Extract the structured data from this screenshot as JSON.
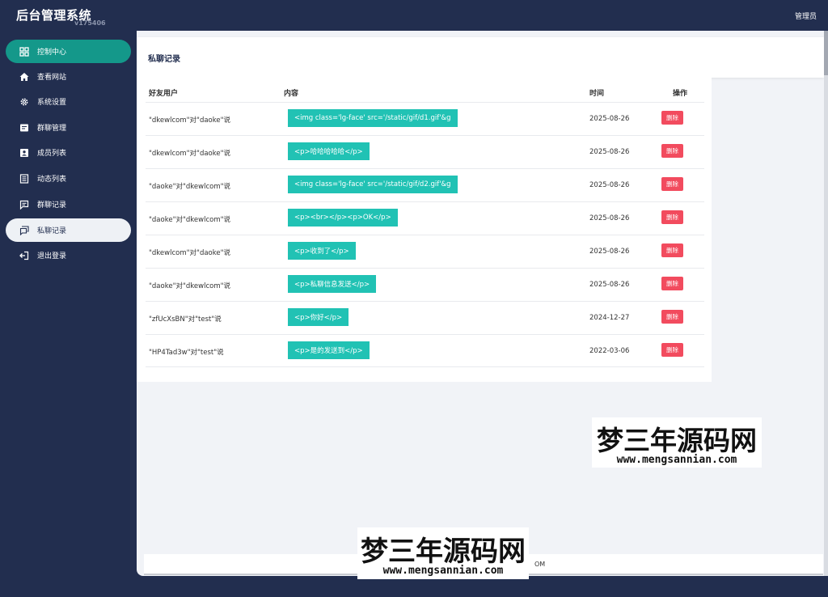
{
  "app": {
    "title": "后台管理系统",
    "version": "v175406",
    "user_role": "管理员"
  },
  "sidebar": {
    "items": [
      {
        "label": "控制中心",
        "icon": "dashboard-icon"
      },
      {
        "label": "查看网站",
        "icon": "home-icon"
      },
      {
        "label": "系统设置",
        "icon": "gear-icon"
      },
      {
        "label": "群聊管理",
        "icon": "chat-manage-icon"
      },
      {
        "label": "成员列表",
        "icon": "member-icon"
      },
      {
        "label": "动态列表",
        "icon": "list-icon"
      },
      {
        "label": "群聊记录",
        "icon": "message-icon"
      },
      {
        "label": "私聊记录",
        "icon": "private-chat-icon"
      },
      {
        "label": "退出登录",
        "icon": "logout-icon"
      }
    ]
  },
  "page": {
    "title": "私聊记录"
  },
  "table": {
    "headers": {
      "user": "好友用户",
      "content": "内容",
      "time": "时间",
      "action": "操作"
    },
    "rows": [
      {
        "user": "\"dkewlcom\"对\"daoke\"说",
        "content": "<img class='lg-face' src='/static/gif/d1.gif'&g",
        "time": "2025-08-26",
        "action": "删除"
      },
      {
        "user": "\"dkewlcom\"对\"daoke\"说",
        "content": "<p>哈哈哈哈哈</p>",
        "time": "2025-08-26",
        "action": "删除"
      },
      {
        "user": "\"daoke\"对\"dkewlcom\"说",
        "content": "<img class='lg-face' src='/static/gif/d2.gif'&g",
        "time": "2025-08-26",
        "action": "删除"
      },
      {
        "user": "\"daoke\"对\"dkewlcom\"说",
        "content": "<p><br></p><p>OK</p>",
        "time": "2025-08-26",
        "action": "删除"
      },
      {
        "user": "\"dkewlcom\"对\"daoke\"说",
        "content": "<p>收到了</p>",
        "time": "2025-08-26",
        "action": "删除"
      },
      {
        "user": "\"daoke\"对\"dkewlcom\"说",
        "content": "<p>私聊信息发送</p>",
        "time": "2025-08-26",
        "action": "删除"
      },
      {
        "user": "\"zfUcXsBN\"对\"test\"说",
        "content": "<p>你好</p>",
        "time": "2024-12-27",
        "action": "删除"
      },
      {
        "user": "\"HP4Tad3w\"对\"test\"说",
        "content": "<p>是的发送到</p>",
        "time": "2022-03-06",
        "action": "删除"
      }
    ]
  },
  "footer": {
    "text": "OM"
  },
  "watermark": {
    "title": "梦三年源码网",
    "url": "www.mengsannian.com"
  },
  "colors": {
    "nav_bg": "#222e4f",
    "accent": "#14988a",
    "tag": "#21c2b4",
    "delete": "#f24b5e"
  }
}
